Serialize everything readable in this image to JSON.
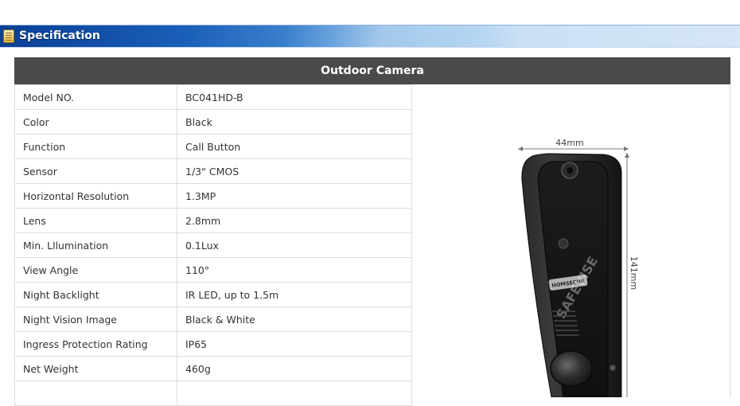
{
  "section": {
    "title": "Specification",
    "icon": "document-icon"
  },
  "table": {
    "header": "Outdoor Camera",
    "rows": [
      {
        "key": "Model NO.",
        "value": "BC041HD-B"
      },
      {
        "key": "Color",
        "value": "Black"
      },
      {
        "key": "Function",
        "value": "Call Button"
      },
      {
        "key": "Sensor",
        "value": "1/3\" CMOS"
      },
      {
        "key": "Horizontal Resolution",
        "value": "1.3MP"
      },
      {
        "key": "Lens",
        "value": "2.8mm"
      },
      {
        "key": "Min. Lllumination",
        "value": "0.1Lux"
      },
      {
        "key": "View Angle",
        "value": "110°"
      },
      {
        "key": "Night Backlight",
        "value": "IR LED, up to 1.5m"
      },
      {
        "key": "Night Vision Image",
        "value": "Black & White"
      },
      {
        "key": "Ingress Protection Rating",
        "value": "IP65"
      },
      {
        "key": "Net Weight",
        "value": "460g"
      }
    ]
  },
  "product_image": {
    "width_label": "44mm",
    "height_label": "141mm",
    "brand_label": "HOMSECUR",
    "watermark": "SAFEVISE"
  }
}
